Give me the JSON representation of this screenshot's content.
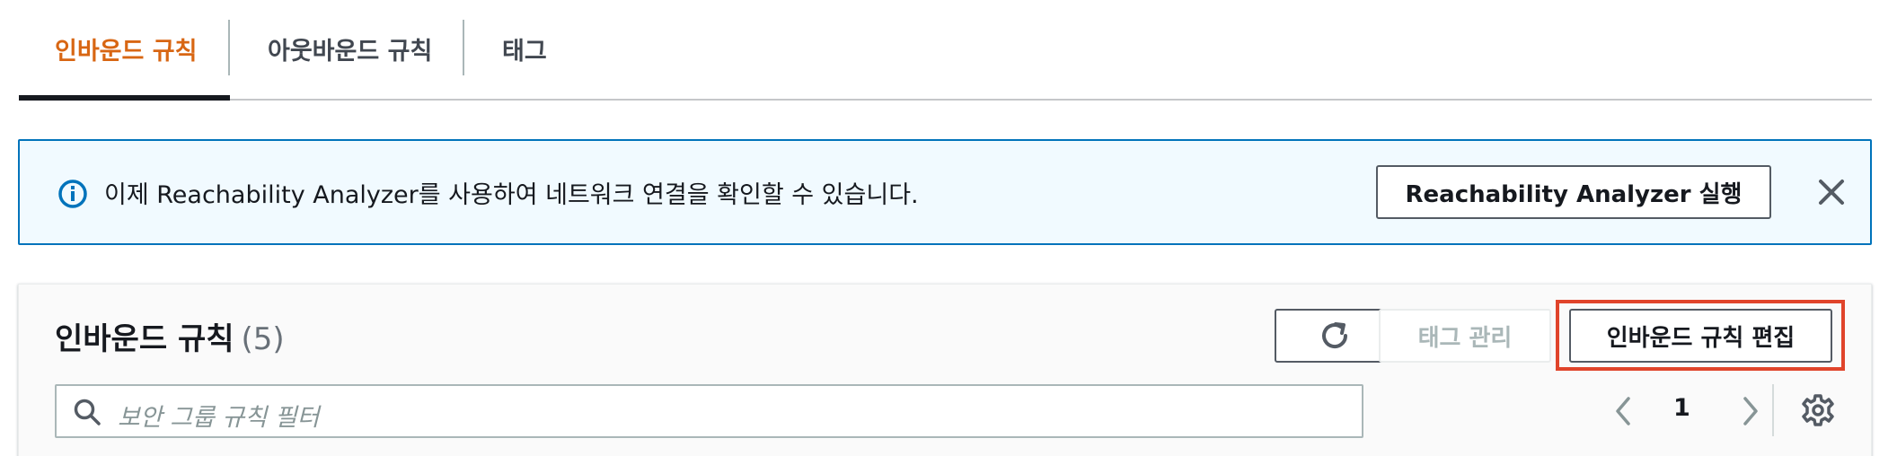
{
  "tabs": [
    {
      "label": "인바운드 규칙",
      "active": true
    },
    {
      "label": "아웃바운드 규칙",
      "active": false
    },
    {
      "label": "태그",
      "active": false
    }
  ],
  "flash": {
    "icon": "info-icon",
    "message": "이제 Reachability Analyzer를 사용하여 네트워크 연결을 확인할 수 있습니다.",
    "action_label": "Reachability Analyzer 실행",
    "close_icon": "close-icon",
    "accent_color": "#0073bb"
  },
  "panel": {
    "title": "인바운드 규칙",
    "count": "(5)",
    "refresh_icon": "refresh-icon",
    "manage_tags_label": "태그 관리",
    "edit_label": "인바운드 규칙 편집",
    "search_placeholder": "보안 그룹 규칙 필터",
    "search_value": "",
    "page_number": "1",
    "settings_icon": "gear-icon",
    "highlight_color": "#e0442b"
  },
  "colors": {
    "active_tab": "#d86613",
    "text": "#16191f",
    "disabled_text": "#aab7b8"
  }
}
